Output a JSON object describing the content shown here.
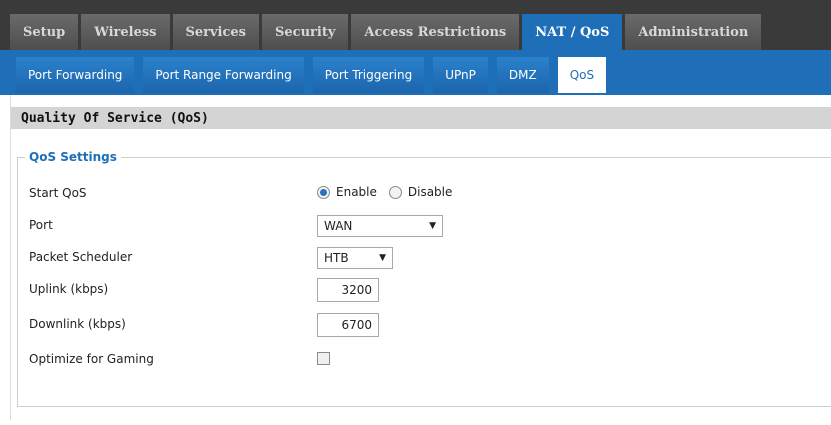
{
  "top_tabs": [
    {
      "label": "Setup",
      "active": false
    },
    {
      "label": "Wireless",
      "active": false
    },
    {
      "label": "Services",
      "active": false
    },
    {
      "label": "Security",
      "active": false
    },
    {
      "label": "Access Restrictions",
      "active": false
    },
    {
      "label": "NAT / QoS",
      "active": true
    },
    {
      "label": "Administration",
      "active": false
    }
  ],
  "sub_tabs": [
    {
      "label": "Port Forwarding",
      "active": false
    },
    {
      "label": "Port Range Forwarding",
      "active": false
    },
    {
      "label": "Port Triggering",
      "active": false
    },
    {
      "label": "UPnP",
      "active": false
    },
    {
      "label": "DMZ",
      "active": false
    },
    {
      "label": "QoS",
      "active": true
    }
  ],
  "section_title": "Quality Of Service (QoS)",
  "fieldset_legend": "QoS Settings",
  "settings": {
    "start_qos": {
      "label": "Start QoS",
      "enable_label": "Enable",
      "disable_label": "Disable",
      "selected": "Enable"
    },
    "port": {
      "label": "Port",
      "value": "WAN"
    },
    "packet_scheduler": {
      "label": "Packet Scheduler",
      "value": "HTB"
    },
    "uplink": {
      "label": "Uplink (kbps)",
      "value": "3200"
    },
    "downlink": {
      "label": "Downlink (kbps)",
      "value": "6700"
    },
    "optimize_gaming": {
      "label": "Optimize for Gaming",
      "checked": false
    }
  },
  "colors": {
    "accent": "#1f6fb8",
    "top_bar": "#3a3a3a"
  }
}
